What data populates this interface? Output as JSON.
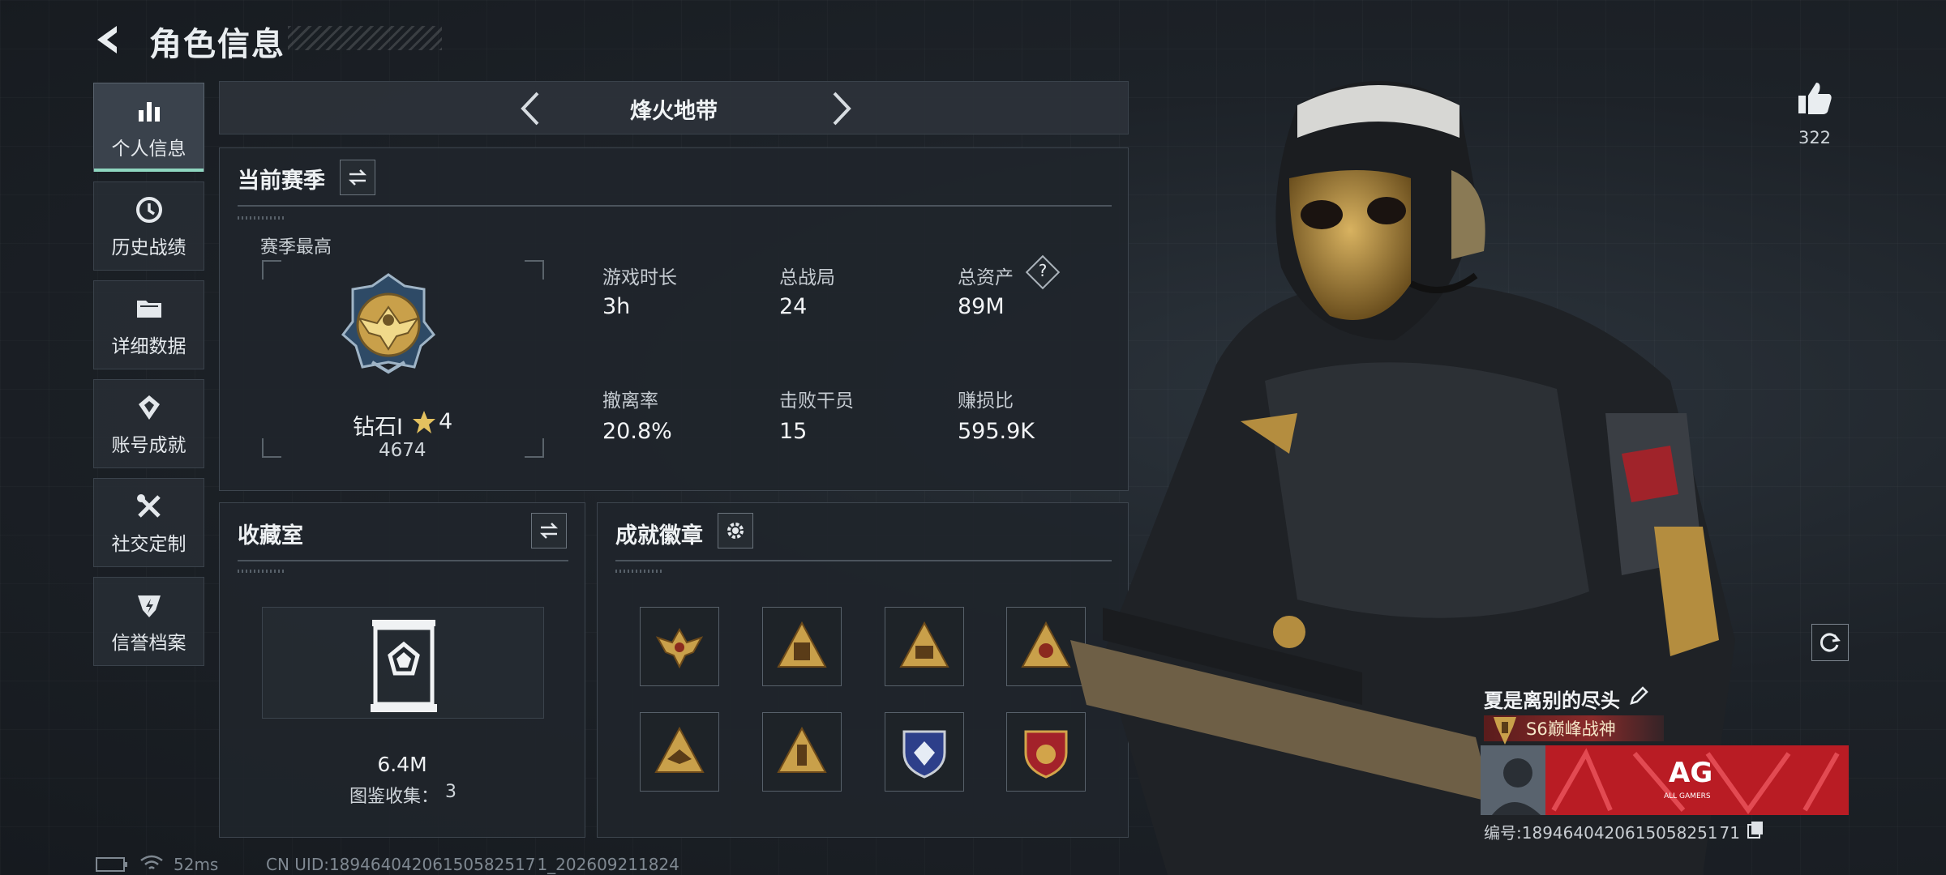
{
  "header": {
    "title": "角色信息"
  },
  "nav": [
    {
      "id": "personal",
      "label": "个人信息",
      "icon": "bar-chart-icon",
      "active": true
    },
    {
      "id": "history",
      "label": "历史战绩",
      "icon": "clock-icon"
    },
    {
      "id": "details",
      "label": "详细数据",
      "icon": "folder-icon"
    },
    {
      "id": "achievements",
      "label": "账号成就",
      "icon": "medal-icon"
    },
    {
      "id": "social",
      "label": "社交定制",
      "icon": "tools-icon"
    },
    {
      "id": "credit",
      "label": "信誉档案",
      "icon": "shield-icon"
    }
  ],
  "mode": {
    "title": "烽火地带"
  },
  "season": {
    "title": "当前赛季",
    "best_label": "赛季最高",
    "rank_name": "钻石Ⅰ",
    "rank_stars": "4",
    "rank_points": "4674",
    "stats": [
      {
        "label": "游戏时长",
        "value": "3h"
      },
      {
        "label": "总战局",
        "value": "24"
      },
      {
        "label": "总资产",
        "value": "89M",
        "help": "?"
      },
      {
        "label": "撤离率",
        "value": "20.8%"
      },
      {
        "label": "击败干员",
        "value": "15"
      },
      {
        "label": "赚损比",
        "value": "595.9K"
      }
    ]
  },
  "collection": {
    "title": "收藏室",
    "value": "6.4M",
    "catalog_label": "图鉴收集：",
    "catalog_count": "3"
  },
  "badges": {
    "title": "成就徽章",
    "items": [
      {
        "icon": "eagle-emblem-icon"
      },
      {
        "icon": "triangle-cargo-icon"
      },
      {
        "icon": "triangle-s6-icon"
      },
      {
        "icon": "triangle-crest-icon"
      },
      {
        "icon": "triangle-wings-icon"
      },
      {
        "icon": "triangle-bottle-icon"
      },
      {
        "icon": "blue-diamond-shield-icon"
      },
      {
        "icon": "red-star-shield-icon"
      }
    ]
  },
  "likes": {
    "count": "322"
  },
  "player": {
    "name": "夏是离别的尽头",
    "rank_title": "S6巅峰战神",
    "banner_text": "AG",
    "banner_sub": "ALL GAMERS",
    "id_label": "编号:",
    "id_value": "1894640420615058251 71"
  },
  "footer": {
    "ping": "52ms",
    "uid": "CN UID:18946404206150582517 1_202609211824"
  },
  "colors": {
    "accent": "#8fd6c0",
    "gold": "#c9a04a",
    "banner_red": "#b91c24"
  }
}
